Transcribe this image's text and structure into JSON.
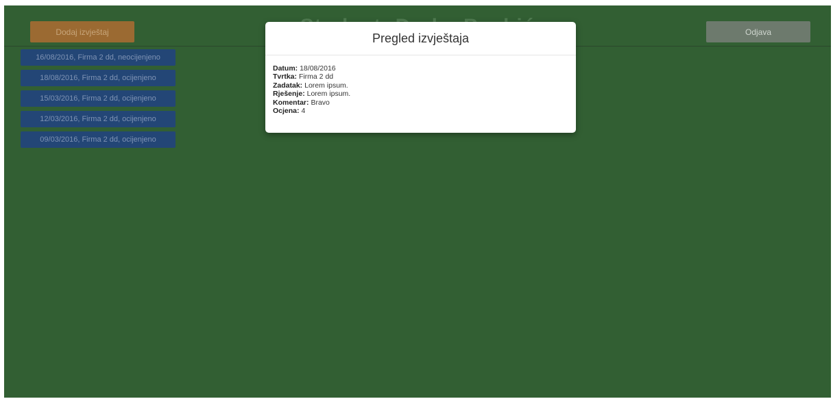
{
  "header": {
    "title": "Student: Darko Basbić",
    "add_report_label": "Dodaj izvještaj",
    "logout_label": "Odjava"
  },
  "reports": [
    {
      "label": "16/08/2016, Firma 2 dd, neocijenjeno"
    },
    {
      "label": "18/08/2016, Firma 2 dd, ocijenjeno"
    },
    {
      "label": "15/03/2016, Firma 2 dd, ocijenjeno"
    },
    {
      "label": "12/03/2016, Firma 2 dd, ocijenjeno"
    },
    {
      "label": "09/03/2016, Firma 2 dd, ocijenjeno"
    }
  ],
  "modal": {
    "title": "Pregled izvještaja",
    "fields": [
      {
        "label": "Datum:",
        "value": "18/08/2016"
      },
      {
        "label": "Tvrtka:",
        "value": "Firma 2 dd"
      },
      {
        "label": "Zadatak:",
        "value": "Lorem ipsum."
      },
      {
        "label": "Rješenje:",
        "value": "Lorem ipsum."
      },
      {
        "label": "Komentar:",
        "value": "Bravo"
      },
      {
        "label": "Ocjena:",
        "value": "4"
      }
    ]
  },
  "colors": {
    "background": "#325f33",
    "add_button": "#9b6a32",
    "report_item": "#234676",
    "logout_button": "#6d7a6d"
  }
}
